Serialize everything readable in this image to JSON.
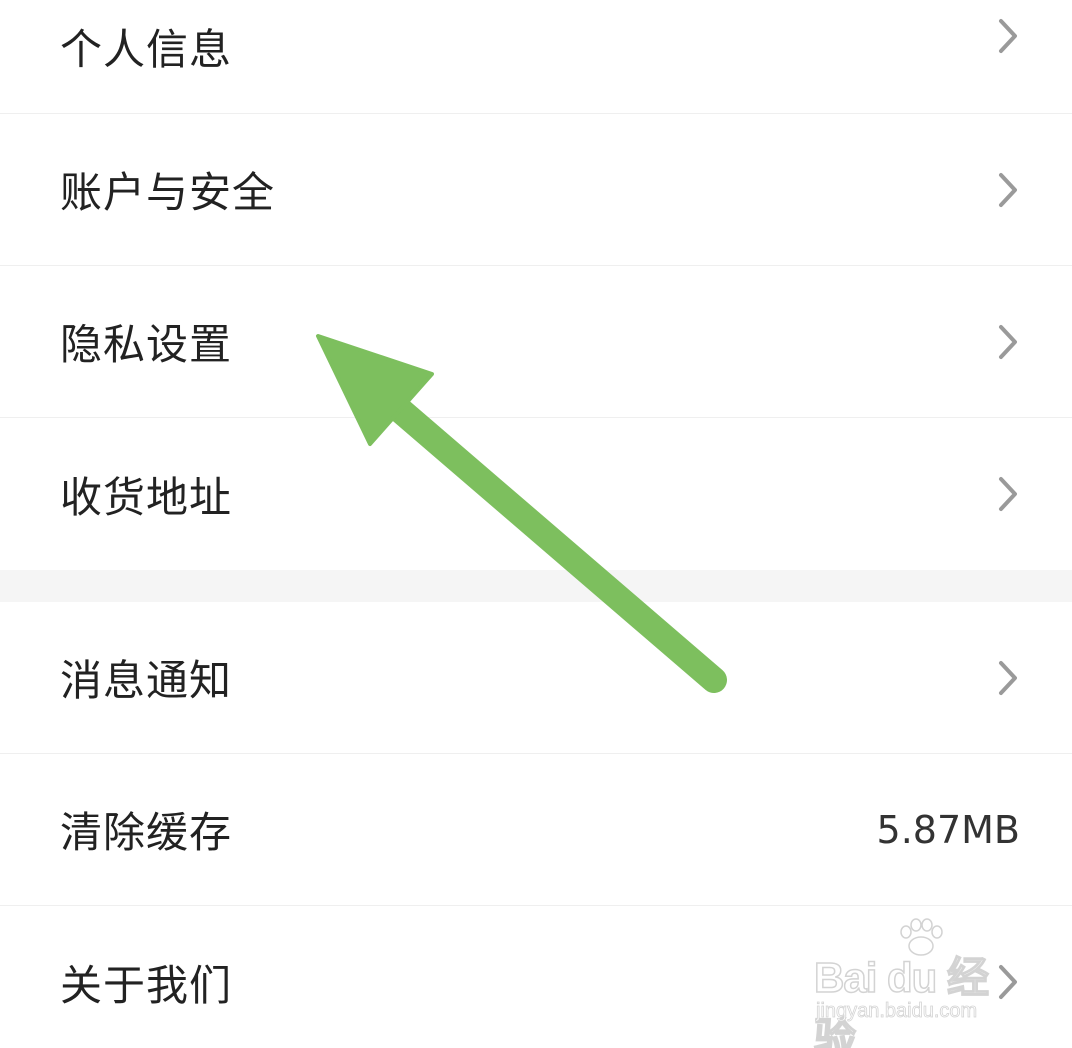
{
  "settings_group_1": [
    {
      "label": "个人信息",
      "icon": "chevron-right-icon"
    },
    {
      "label": "账户与安全",
      "icon": "chevron-right-icon"
    },
    {
      "label": "隐私设置",
      "icon": "chevron-right-icon"
    },
    {
      "label": "收货地址",
      "icon": "chevron-right-icon"
    }
  ],
  "settings_group_2": [
    {
      "label": "消息通知",
      "icon": "chevron-right-icon"
    },
    {
      "label": "清除缓存",
      "value": "5.87MB"
    },
    {
      "label": "关于我们",
      "icon": "chevron-right-icon"
    }
  ],
  "annotation": {
    "arrow_color": "#7dbf5e",
    "points_to": "隐私设置"
  },
  "watermark": {
    "logo_text": "Bai du 经验",
    "url_text": "jingyan.baidu.com"
  },
  "colors": {
    "text": "#222222",
    "chevron": "#9a9a9a",
    "divider": "#efefef",
    "section_gap": "#f5f5f5"
  }
}
